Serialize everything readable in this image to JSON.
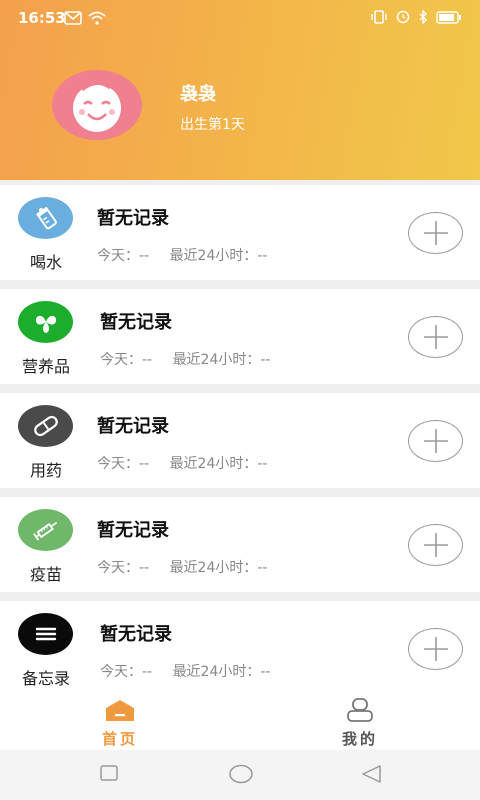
{
  "status": {
    "time": "16:53"
  },
  "profile": {
    "name": "袅袅",
    "age": "出生第1天"
  },
  "records": [
    {
      "category": "喝水",
      "icon": "baby-bottle-icon",
      "color": "#6aaee0",
      "title": "暂无记录",
      "today": "今天：--",
      "last24": "最近24小时：--"
    },
    {
      "category": "营养品",
      "icon": "leaf-icon",
      "color": "#1cad2c",
      "title": "暂无记录",
      "today": "今天：--",
      "last24": "最近24小时：--"
    },
    {
      "category": "用药",
      "icon": "pill-icon",
      "color": "#4a4a4a",
      "title": "暂无记录",
      "today": "今天：--",
      "last24": "最近24小时：--"
    },
    {
      "category": "疫苗",
      "icon": "syringe-icon",
      "color": "#6fb86a",
      "title": "暂无记录",
      "today": "今天：--",
      "last24": "最近24小时：--"
    },
    {
      "category": "备忘录",
      "icon": "menu-lines-icon",
      "color": "#0a0a0a",
      "title": "暂无记录",
      "today": "今天：--",
      "last24": "最近24小时：--"
    }
  ],
  "tabs": {
    "home": "首页",
    "mine": "我的"
  },
  "colors": {
    "accent": "#f09a40",
    "header_start": "#f4a04c",
    "header_end": "#f1c84a"
  }
}
